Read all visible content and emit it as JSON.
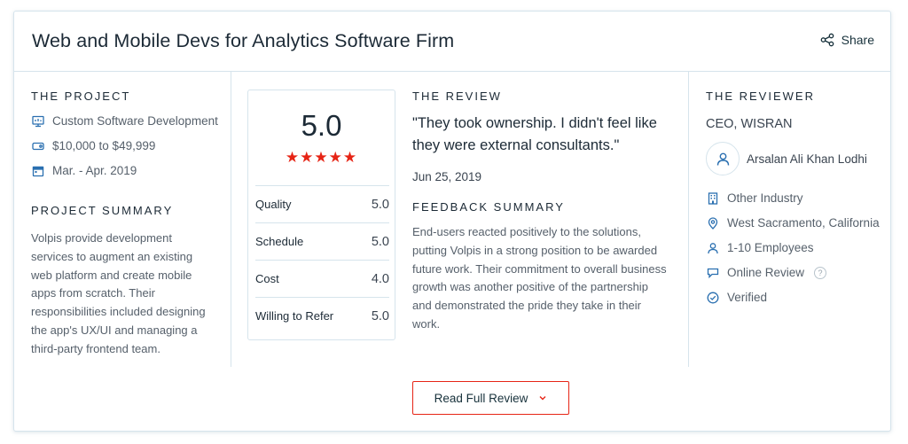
{
  "header": {
    "title": "Web and Mobile Devs for Analytics Software Firm",
    "share_label": "Share"
  },
  "project": {
    "section_label": "THE PROJECT",
    "service": "Custom Software Development",
    "budget": "$10,000 to $49,999",
    "dates": "Mar. - Apr. 2019",
    "summary_label": "PROJECT SUMMARY",
    "summary_lines": [
      "Volpis provide development",
      "services to augment an existing",
      "web platform and create mobile",
      "apps from scratch. Their",
      "responsibilities included designing",
      "the app's UX/UI and managing a",
      "third-party frontend team."
    ]
  },
  "ratings": {
    "overall": "5.0",
    "stars": "★★★★★",
    "rows": [
      {
        "label": "Quality",
        "value": "5.0"
      },
      {
        "label": "Schedule",
        "value": "5.0"
      },
      {
        "label": "Cost",
        "value": "4.0"
      },
      {
        "label": "Willing to Refer",
        "value": "5.0"
      }
    ]
  },
  "review": {
    "section_label": "THE REVIEW",
    "quote_lines": [
      "\"They took ownership. I didn't feel like",
      "they were external consultants.\""
    ],
    "date": "Jun 25, 2019",
    "feedback_label": "FEEDBACK SUMMARY",
    "feedback_lines": [
      "End-users reacted positively to the solutions,",
      "putting Volpis in a strong position to be awarded",
      "future work. Their commitment to overall business",
      "growth was another positive of the partnership",
      "and demonstrated the pride they take in their",
      "work."
    ]
  },
  "reviewer": {
    "section_label": "THE REVIEWER",
    "title": "CEO, WISRAN",
    "name": "Arsalan Ali Khan Lodhi",
    "industry": "Other Industry",
    "location": "West Sacramento, California",
    "employees": "1-10 Employees",
    "review_type": "Online Review",
    "help_symbol": "?",
    "verified": "Verified"
  },
  "footer": {
    "read_full_label": "Read Full Review"
  },
  "colors": {
    "accent_red": "#e62415",
    "icon_teal": "#17313b",
    "icon_blue": "#2a6fb0",
    "border": "#d6e4ec"
  },
  "icons": {
    "share": "share-icon",
    "service": "monitor-icon",
    "budget": "price-tag-icon",
    "dates": "calendar-icon",
    "avatar": "user-icon",
    "industry": "building-icon",
    "location": "location-pin-icon",
    "employees": "person-icon",
    "review_type": "chat-bubble-icon",
    "verified": "check-circle-icon",
    "button": "chevron-down-icon"
  }
}
